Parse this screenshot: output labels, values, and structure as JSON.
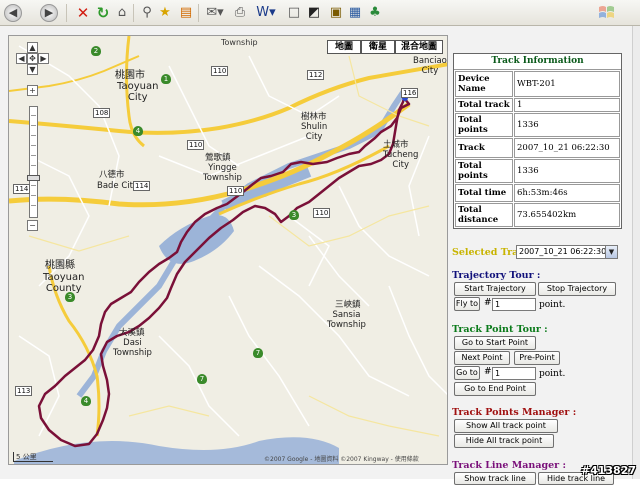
{
  "toolbar": {
    "icons": [
      "back-icon",
      "forward-icon",
      "stop-icon",
      "refresh-icon",
      "home-icon",
      "search-icon",
      "favorites-icon",
      "feeds-icon",
      "mail-icon",
      "print-icon",
      "word-icon",
      "blank-icon",
      "kodak-icon",
      "research-icon",
      "messenger-icon"
    ]
  },
  "map": {
    "types": {
      "map": "地圖",
      "satellite": "衛星",
      "hybrid": "混合地圖"
    },
    "labels": {
      "township_top": "Township",
      "taoyuan_city_zh": "桃園市",
      "taoyuan_city_en": "Taoyuan\nCity",
      "bade_zh": "八德市",
      "bade_en": "Bade City",
      "yingge_zh": "鶯歌鎮",
      "yingge_en": "Yingge\nTownship",
      "shulin_zh": "樹林市",
      "shulin_en": "Shulin\nCity",
      "tucheng_zh": "土城市",
      "tucheng_en": "Tucheng\nCity",
      "banciao": "Banciao\nCity",
      "taoyuan_county_zh": "桃園縣",
      "taoyuan_county_en": "Taoyuan\nCounty",
      "dasi_zh": "大溪鎮",
      "dasi_en": "Dasi\nTownship",
      "sansia_zh": "三峽鎮",
      "sansia_en": "Sansia\nTownship"
    },
    "shields": [
      "2",
      "1",
      "110",
      "108",
      "110",
      "4",
      "114",
      "110",
      "3",
      "110",
      "112",
      "116",
      "114",
      "7",
      "7",
      "3",
      "113",
      "4"
    ],
    "copyright": "©2007 Google - 地圖資料 ©2007 Kingway - 使用條款",
    "scale": "5 公里"
  },
  "panel": {
    "info_title": "Track Information",
    "rows": [
      {
        "k": "Device Name",
        "v": "WBT-201"
      },
      {
        "k": "Total track",
        "v": "1"
      },
      {
        "k": "Total points",
        "v": "1336"
      },
      {
        "k": "Track",
        "v": "2007_10_21 06:22:30"
      },
      {
        "k": "Total points",
        "v": "1336"
      },
      {
        "k": "Total time",
        "v": "6h:53m:46s"
      },
      {
        "k": "Total distance",
        "v": "73.655402km"
      }
    ],
    "selected_track_label": "Selected Track:",
    "selected_track_value": "2007_10_21 06:22:30",
    "trajectory_tour": "Trajectory Tour :",
    "start_trajectory": "Start Trajectory",
    "stop_trajectory": "Stop Trajectory",
    "fly_to": "Fly to",
    "hash": "#",
    "fly_value": "1",
    "point_suffix": "point.",
    "track_point_tour": "Track Point Tour :",
    "go_start": "Go to Start Point",
    "next_point": "Next Point",
    "pre_point": "Pre-Point",
    "go_to": "Go to",
    "go_value": "1",
    "go_end": "Go to End Point",
    "points_manager": "Track Points Manager :",
    "show_all": "Show All track point",
    "hide_all": "Hide All track point",
    "line_manager": "Track Line Manager :",
    "show_line": "Show track line",
    "hide_line": "Hide track line"
  },
  "watermark": "#413827",
  "colors": {
    "track": "#7a1038",
    "green_title": "#0a5a1a",
    "yellow_label": "#c8b400",
    "navy": "#10107a",
    "red_label": "#a01010",
    "purple": "#7a107a"
  }
}
